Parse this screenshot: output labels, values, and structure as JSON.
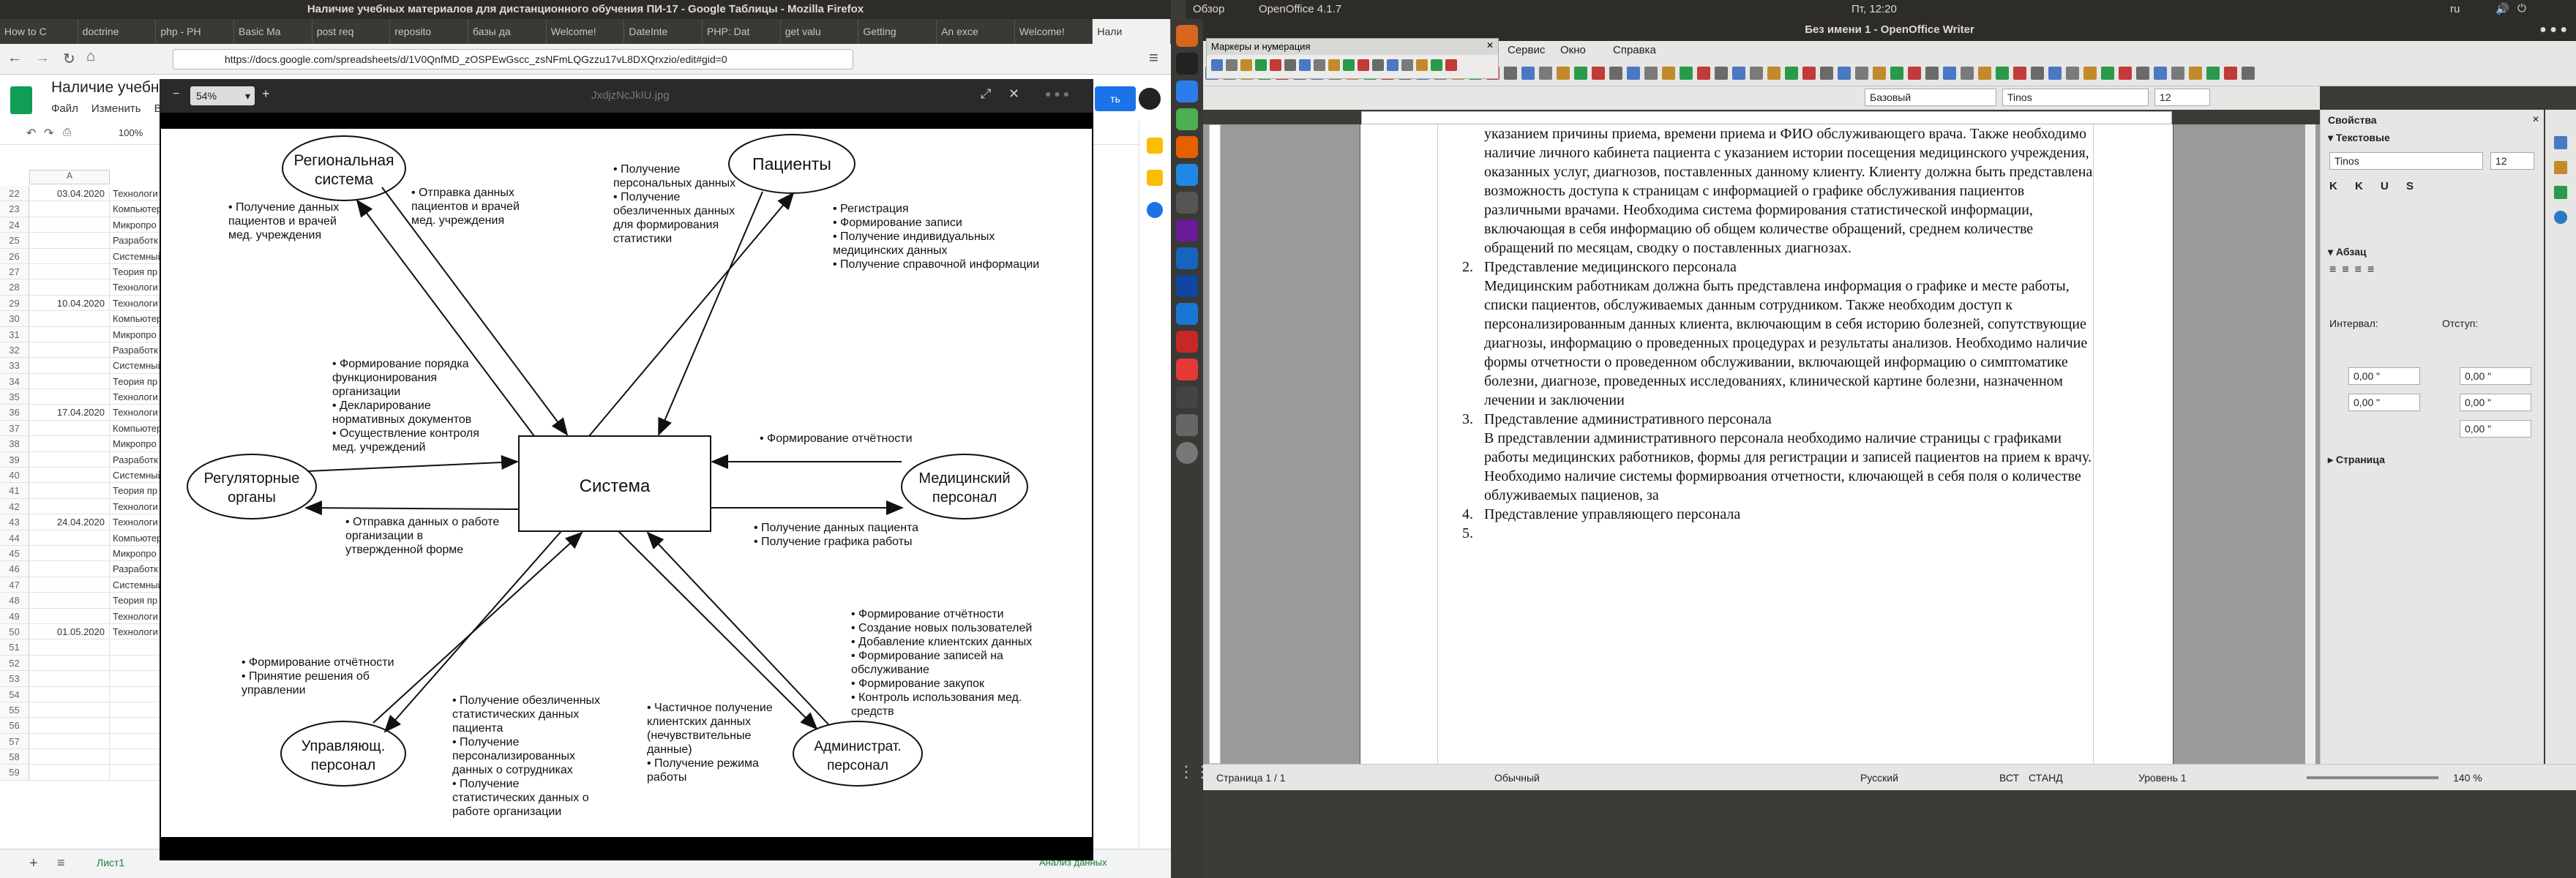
{
  "firefox": {
    "title": "Наличие учебных материалов для дистанционного обучения ПИ-17 - Google Таблицы - Mozilla Firefox",
    "tabs": [
      "How to C",
      "doctrine",
      "php - PH",
      "Basic Ma",
      "post req",
      "reposito",
      "базы да",
      "Welcome!",
      "DateInte",
      "PHP: Dat",
      "get valu",
      "Getting",
      "An exce",
      "Welcome!",
      "Нали"
    ],
    "url": "https://docs.google.com/spreadsheets/d/1V0QnfMD_zOSPEwGscc_zsNFmLQGzzu17vL8DXQrxzio/edit#gid=0"
  },
  "sheets": {
    "doc_title": "Наличие учебны",
    "menu": [
      "Файл",
      "Изменить",
      "Ви"
    ],
    "zoom": "100%",
    "col_a": "A",
    "rows": [
      {
        "n": "22",
        "a": "03.04.2020",
        "b": "Технологи"
      },
      {
        "n": "23",
        "a": "",
        "b": "Компьютер"
      },
      {
        "n": "24",
        "a": "",
        "b": "Микропро"
      },
      {
        "n": "25",
        "a": "",
        "b": "Разработк"
      },
      {
        "n": "26",
        "a": "",
        "b": "Системный"
      },
      {
        "n": "27",
        "a": "",
        "b": "Теория пр"
      },
      {
        "n": "28",
        "a": "",
        "b": "Технологи"
      },
      {
        "n": "29",
        "a": "10.04.2020",
        "b": "Технологи"
      },
      {
        "n": "30",
        "a": "",
        "b": "Компьютер"
      },
      {
        "n": "31",
        "a": "",
        "b": "Микропро"
      },
      {
        "n": "32",
        "a": "",
        "b": "Разработк"
      },
      {
        "n": "33",
        "a": "",
        "b": "Системный"
      },
      {
        "n": "34",
        "a": "",
        "b": "Теория пр"
      },
      {
        "n": "35",
        "a": "",
        "b": "Технологи"
      },
      {
        "n": "36",
        "a": "17.04.2020",
        "b": "Технологи"
      },
      {
        "n": "37",
        "a": "",
        "b": "Компьютер"
      },
      {
        "n": "38",
        "a": "",
        "b": "Микропро"
      },
      {
        "n": "39",
        "a": "",
        "b": "Разработк"
      },
      {
        "n": "40",
        "a": "",
        "b": "Системный"
      },
      {
        "n": "41",
        "a": "",
        "b": "Теория пр"
      },
      {
        "n": "42",
        "a": "",
        "b": "Технологи"
      },
      {
        "n": "43",
        "a": "24.04.2020",
        "b": "Технологи"
      },
      {
        "n": "44",
        "a": "",
        "b": "Компьютер"
      },
      {
        "n": "45",
        "a": "",
        "b": "Микропро"
      },
      {
        "n": "46",
        "a": "",
        "b": "Разработк"
      },
      {
        "n": "47",
        "a": "",
        "b": "Системный"
      },
      {
        "n": "48",
        "a": "",
        "b": "Теория пр"
      },
      {
        "n": "49",
        "a": "",
        "b": "Технологи"
      },
      {
        "n": "50",
        "a": "01.05.2020",
        "b": "Технологи"
      },
      {
        "n": "51",
        "a": "",
        "b": ""
      },
      {
        "n": "52",
        "a": "",
        "b": ""
      },
      {
        "n": "53",
        "a": "",
        "b": ""
      },
      {
        "n": "54",
        "a": "",
        "b": ""
      },
      {
        "n": "55",
        "a": "",
        "b": ""
      },
      {
        "n": "56",
        "a": "",
        "b": ""
      },
      {
        "n": "57",
        "a": "",
        "b": ""
      },
      {
        "n": "58",
        "a": "",
        "b": ""
      },
      {
        "n": "59",
        "a": "",
        "b": ""
      }
    ],
    "sheet_tab": "Лист1",
    "explore": "Анализ данных",
    "share": "ть"
  },
  "viewer": {
    "zoom": "54%",
    "filename": "JxdjzNcJkIU.jpg"
  },
  "diagram": {
    "center": "Система",
    "nodes": {
      "regional": [
        "Региональная",
        "система"
      ],
      "patients": "Пациенты",
      "regulatory": [
        "Регуляторные",
        "органы"
      ],
      "medical": [
        "Медицинский",
        "персонал"
      ],
      "manager": [
        "Управляющ.",
        "персонал"
      ],
      "admin": [
        "Администрат.",
        "персонал"
      ]
    },
    "labels": {
      "l1": [
        "Получение данных",
        "пациентов и врачей",
        "мед. учреждения"
      ],
      "l2": [
        "Отправка данных",
        "пациентов и врачей",
        "мед. учреждения"
      ],
      "l3": [
        "Получение",
        "персональных данных",
        "Получение",
        "обезличенных данных",
        "для формирования",
        "статистики"
      ],
      "l4": [
        "Регистрация",
        "Формирование записи",
        "Получение индивидуальных",
        "медицинских данных",
        "Получение справочной информации"
      ],
      "l5": [
        "Формирование порядка",
        "функционирования",
        "организации",
        "Декларирование",
        "нормативных документов",
        "Осуществление контроля",
        "мед. учреждений"
      ],
      "l6": [
        "Формирование отчётности"
      ],
      "l7": [
        "Отправка данных о работе",
        "организации в",
        "утвержденной форме"
      ],
      "l8": [
        "Получение данных пациента",
        "Получение графика работы"
      ],
      "l9": [
        "Формирование отчётности",
        "Создание новых пользователей",
        "Добавление клиентских данных",
        "Формирование записей на",
        "обслуживание",
        "Формирование закупок",
        "Контроль использования мед.",
        "средств"
      ],
      "l10": [
        "Формирование отчётности",
        "Принятие решения об",
        "управлении"
      ],
      "l11": [
        "Получение обезличенных",
        "статистических данных",
        "пациента",
        "Получение",
        "персонализированных",
        "данных о сотрудниках",
        "Получение",
        "статистических данных о",
        "работе организации"
      ],
      "l12": [
        "Частичное получение",
        "клиентских данных",
        "(нечувствительные",
        "данные)",
        "Получение режима",
        "работы"
      ]
    }
  },
  "system": {
    "activities": "Обзор",
    "app": "OpenOffice 4.1.7",
    "clock": "Пт, 12:20",
    "lang": "ru"
  },
  "writer": {
    "title": "Без имени 1 - OpenOffice Writer",
    "menu": [
      "Сервис",
      "Окно",
      "Справка"
    ],
    "float_toolbar": "Маркеры и нумерация",
    "style": "Базовый",
    "font": "Tinos",
    "size": "12",
    "paragraphs": {
      "p0": "указанием причины приема, времени приема и ФИО обслуживающего врача. Также необходимо наличие личного кабинета пациента с указанием истории посещения медицинского учреждения, оказанных услуг, диагнозов, поставленных данному клиенту. Клиенту должна быть представлена возможность доступа к страницам с информацией о графике обслуживания пациентов различными врачами. Необходима система формирования статистической информации, включающая в себя информацию об общем количестве обращений, среднем количестве обращений по месяцам, сводку о поставленных диагнозах.",
      "n2": "2.",
      "h2": "Представление медицинского персонала",
      "p2": "Медицинским работникам должна быть представлена информация о графике и месте работы, списки пациентов, обслуживаемых данным сотрудником. Также необходим доступ к персонализированным данных клиента, включающим в себя историю болезней, сопутствующие диагнозы, информацию о проведенных процедурах и результаты анализов. Необходимо наличие формы отчетности о проведенном обслуживании, включающей информацию о симптоматике болезни, диагнозе, проведенных исследованиях, клинической картине болезни, назначенном лечении и заключении",
      "n3": "3.",
      "h3": "Представление административного персонала",
      "p3": "В представлении административного персонала необходимо наличие страницы с графиками работы медицинских работников, формы для регистрации и записей пациентов на прием к врачу. Необходимо наличие системы формирвоания отчетности, ключающей в себя поля о количестве облуживаемых пациенов, за",
      "n4": "4.",
      "h4": "Представление управляющего персонала",
      "n5": "5."
    },
    "sidebar": {
      "title": "Свойства",
      "text_section": "Текстовые",
      "font": "Tinos",
      "size": "12",
      "para_section": "Абзац",
      "interval": "Интервал:",
      "indent": "Отступ:",
      "v1": "0,00 \"",
      "v2": "0,00 \"",
      "v3": "0,00 \"",
      "v4": "0,00 \"",
      "v5": "0,00 \"",
      "page_section": "Страница"
    },
    "status": {
      "page": "Страница 1 / 1",
      "style": "Обычный",
      "lang": "Русский",
      "ins": "ВСТ",
      "std": "СТАНД",
      "level": "Уровень 1",
      "zoom": "140 %"
    }
  }
}
